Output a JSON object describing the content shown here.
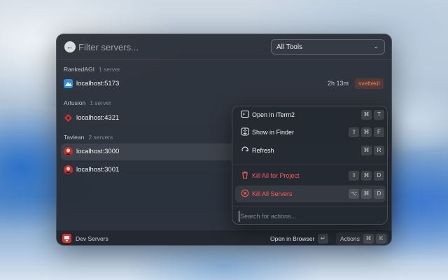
{
  "search": {
    "placeholder": "Filter servers..."
  },
  "filter_select": {
    "value": "All Tools"
  },
  "groups": [
    {
      "name": "RankedAGI",
      "count": "1 server"
    },
    {
      "name": "Artusion",
      "count": "1 server"
    },
    {
      "name": "Tavlean",
      "count": "2 servers"
    }
  ],
  "servers": [
    {
      "label": "localhost:5173",
      "uptime": "2h 13m",
      "badge": "sveltekit",
      "icon": "svelte-icon"
    },
    {
      "label": "localhost:4321",
      "icon": "astro-icon"
    },
    {
      "label": "localhost:3000",
      "icon": "avatar-icon"
    },
    {
      "label": "localhost:3001",
      "icon": "avatar-icon"
    }
  ],
  "footer": {
    "app_title": "Dev Servers",
    "primary_action": "Open in Browser",
    "primary_key": "↵",
    "actions_label": "Actions",
    "actions_keys": [
      "⌘",
      "K"
    ]
  },
  "actions_menu": {
    "items": [
      {
        "label": "Open in iTerm2",
        "icon": "terminal-icon",
        "keys": [
          "⌘",
          "T"
        ]
      },
      {
        "label": "Show in Finder",
        "icon": "finder-icon",
        "keys": [
          "⇧",
          "⌘",
          "F"
        ]
      },
      {
        "label": "Refresh",
        "icon": "refresh-icon",
        "keys": [
          "⌘",
          "R"
        ]
      },
      {
        "label": "Kill All for Project",
        "icon": "trash-icon",
        "keys": [
          "⇧",
          "⌘",
          "D"
        ]
      },
      {
        "label": "Kill All Servers",
        "icon": "close-circle-icon",
        "keys": [
          "⌥",
          "⌘",
          "D"
        ]
      }
    ],
    "search_placeholder": "Search for actions..."
  },
  "colors": {
    "danger": "#ff5a5a",
    "badge": "#ff7a45",
    "accent_red": "#d8312e"
  }
}
